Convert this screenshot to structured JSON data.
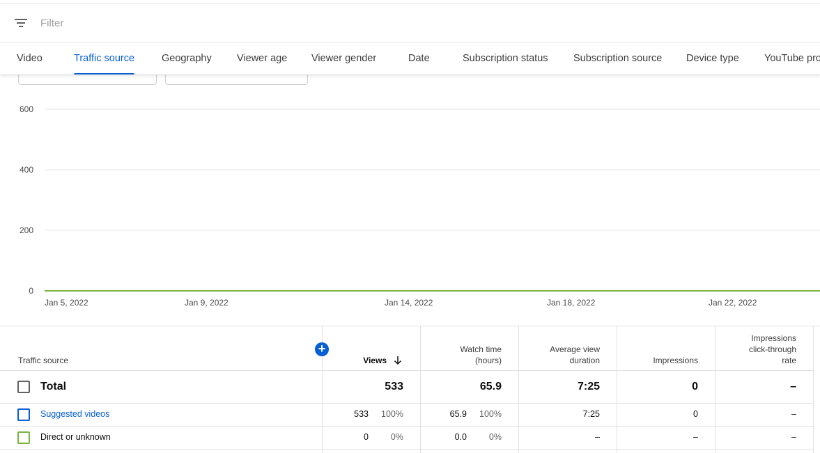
{
  "filter": {
    "placeholder": "Filter"
  },
  "tabs": [
    {
      "label": "Video"
    },
    {
      "label": "Traffic source"
    },
    {
      "label": "Geography"
    },
    {
      "label": "Viewer age"
    },
    {
      "label": "Viewer gender"
    },
    {
      "label": "Date"
    },
    {
      "label": "Subscription status"
    },
    {
      "label": "Subscription source"
    },
    {
      "label": "Device type"
    },
    {
      "label": "YouTube product"
    }
  ],
  "active_tab": "Traffic source",
  "chart_data": {
    "type": "line",
    "y_ticks": [
      "600",
      "400",
      "200",
      "0"
    ],
    "ylim": [
      0,
      600
    ],
    "x_ticks": [
      "Jan 5, 2022",
      "Jan 9, 2022",
      "Jan 14, 2022",
      "Jan 18, 2022",
      "Jan 22, 2022"
    ],
    "grid": true,
    "series": [
      {
        "color": "#7cb342",
        "values": [
          0,
          0,
          0,
          0,
          0
        ]
      }
    ]
  },
  "table": {
    "headers": {
      "source": "Traffic source",
      "views": "Views",
      "watch_time_1": "Watch time",
      "watch_time_2": "(hours)",
      "avd_1": "Average view",
      "avd_2": "duration",
      "impressions": "Impressions",
      "ctr_1": "Impressions",
      "ctr_2": "click-through",
      "ctr_3": "rate"
    },
    "total": {
      "label": "Total",
      "views": "533",
      "watch_time": "65.9",
      "avd": "7:25",
      "impressions": "0",
      "ctr": "–"
    },
    "rows": [
      {
        "label": "Suggested videos",
        "views": "533",
        "views_pct": "100%",
        "watch_time": "65.9",
        "watch_pct": "100%",
        "avd": "7:25",
        "impressions": "0",
        "ctr": "–",
        "color": "#065fd4"
      },
      {
        "label": "Direct or unknown",
        "views": "0",
        "views_pct": "0%",
        "watch_time": "0.0",
        "watch_pct": "0%",
        "avd": "–",
        "impressions": "–",
        "ctr": "–",
        "color": "#7cb342"
      }
    ]
  }
}
